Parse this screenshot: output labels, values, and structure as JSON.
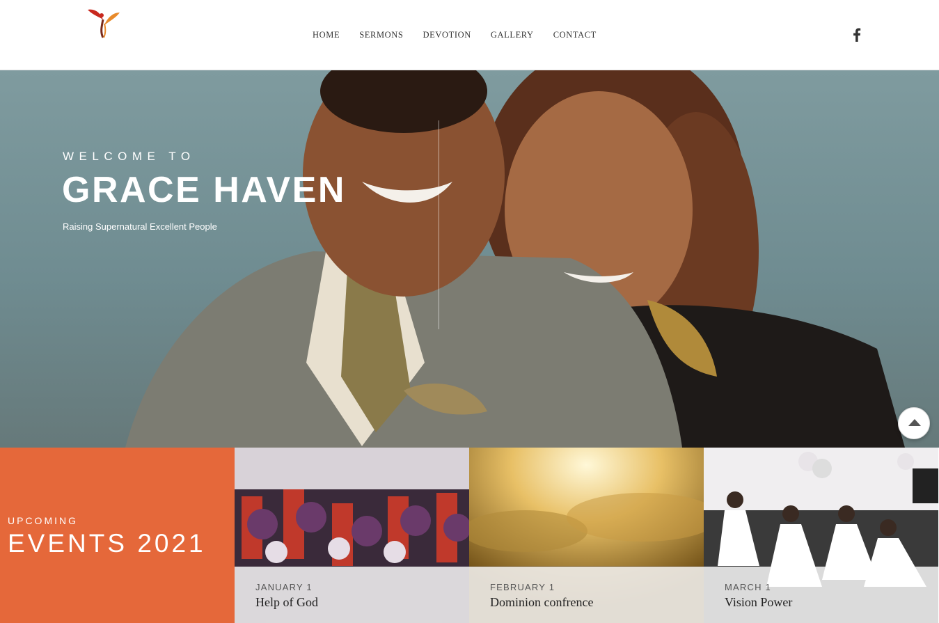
{
  "nav": {
    "items": [
      {
        "label": "HOME"
      },
      {
        "label": "SERMONS"
      },
      {
        "label": "DEVOTION"
      },
      {
        "label": "GALLERY"
      },
      {
        "label": "CONTACT"
      }
    ]
  },
  "social": {
    "icon": "facebook-icon"
  },
  "hero": {
    "welcome": "WELCOME TO",
    "title": "GRACE HAVEN",
    "tagline": "Raising Supernatural Excellent People"
  },
  "events": {
    "kicker": "UPCOMING",
    "heading": "EVENTS 2021",
    "items": [
      {
        "date": "JANUARY 1",
        "title": "Help of God"
      },
      {
        "date": "FEBRUARY 1",
        "title": "Dominion confrence"
      },
      {
        "date": "MARCH 1",
        "title": "Vision Power"
      }
    ]
  },
  "colors": {
    "accent": "#e5683a",
    "hero_bg": "#7f9b9f"
  }
}
